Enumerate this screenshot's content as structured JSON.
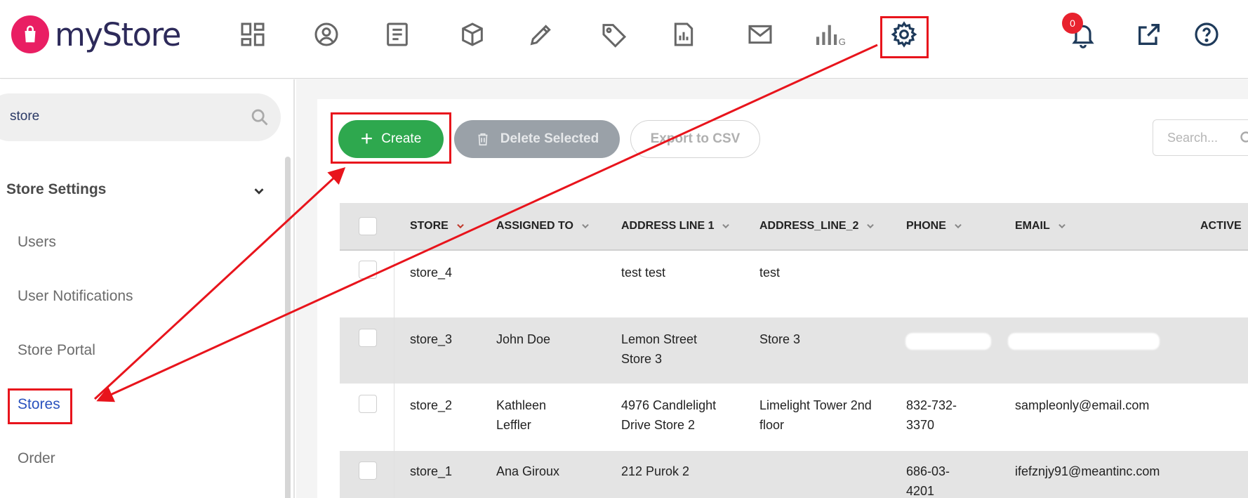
{
  "app": {
    "logo_text": "myStore",
    "brand_color": "#e91e63"
  },
  "topnav": {
    "icons": [
      "dashboard-icon",
      "user-circle-icon",
      "document-icon",
      "box-icon",
      "pencil-icon",
      "tag-icon",
      "report-icon",
      "mail-icon",
      "analytics-icon",
      "gear-icon",
      "bell-icon",
      "external-link-icon",
      "help-icon"
    ],
    "notification_count": "0"
  },
  "sidebar": {
    "search_value": "store",
    "section_title": "Store Settings",
    "items": [
      {
        "label": "Users"
      },
      {
        "label": "User Notifications"
      },
      {
        "label": "Store Portal"
      },
      {
        "label": "Stores",
        "active": true
      },
      {
        "label": "Order"
      }
    ]
  },
  "toolbar": {
    "create_label": "Create",
    "delete_label": "Delete Selected",
    "export_label": "Export to CSV",
    "search_placeholder": "Search..."
  },
  "table": {
    "columns": [
      "STORE",
      "ASSIGNED TO",
      "ADDRESS LINE 1",
      "ADDRESS_LINE_2",
      "PHONE",
      "EMAIL",
      "ACTIVE"
    ],
    "rows": [
      {
        "store": "store_4",
        "assigned": "",
        "addr1": "test test",
        "addr2": "test",
        "phone": "",
        "email": ""
      },
      {
        "store": "store_3",
        "assigned": "John Doe",
        "addr1": "Lemon Street Store 3",
        "addr2": "Store 3",
        "phone": "",
        "email": ""
      },
      {
        "store": "store_2",
        "assigned": "Kathleen Leffler",
        "addr1": "4976 Candlelight Drive Store 2",
        "addr2": "Limelight Tower 2nd floor",
        "phone": "832-732-3370",
        "email": "sampleonly@email.com"
      },
      {
        "store": "store_1",
        "assigned": "Ana Giroux",
        "addr1": "212 Purok 2",
        "addr2": "",
        "phone": "686-03-4201",
        "email": "ifefznjy91@meantinc.com"
      }
    ]
  },
  "colors": {
    "annotation_red": "#e8141c",
    "create_green": "#2ea84e",
    "active_link": "#2a52be"
  }
}
